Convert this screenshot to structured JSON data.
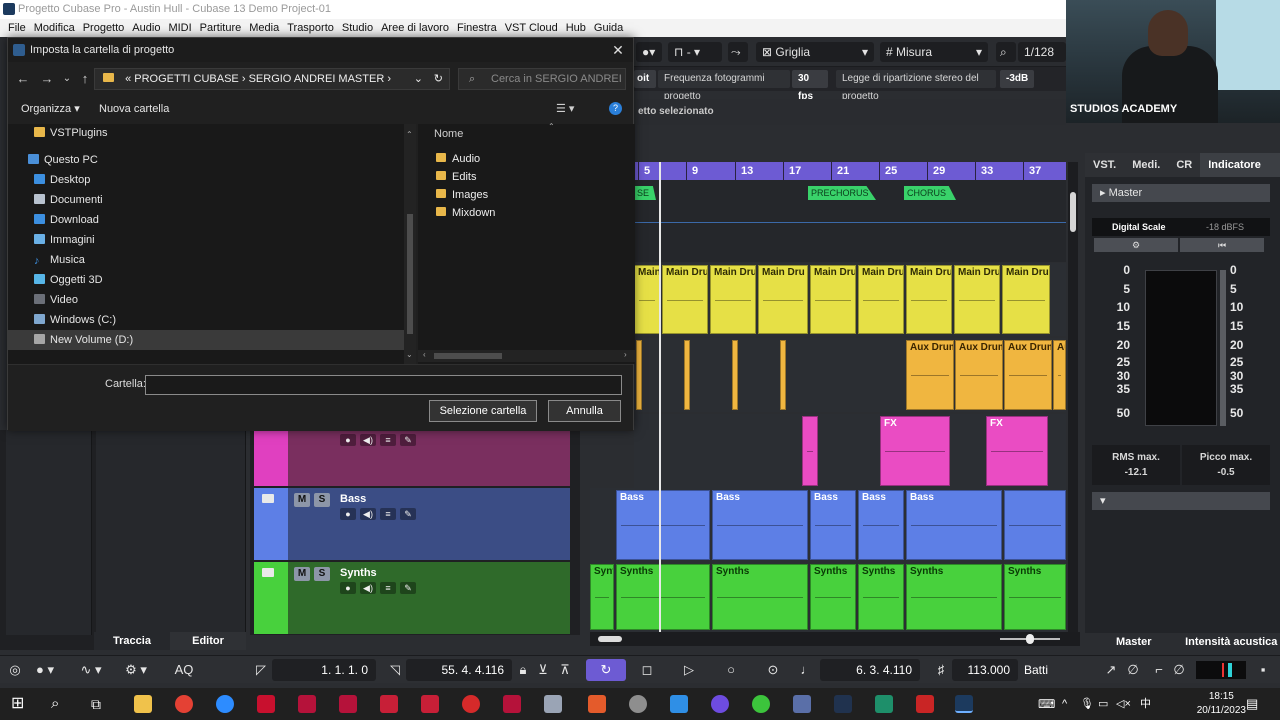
{
  "window": {
    "title": "Progetto Cubase Pro - Austin Hull - Cubase 13 Demo Project-01"
  },
  "menu": [
    "File",
    "Modifica",
    "Progetto",
    "Audio",
    "MIDI",
    "Partiture",
    "Media",
    "Trasporto",
    "Studio",
    "Aree di lavoro",
    "Finestra",
    "VST Cloud",
    "Hub",
    "Guida"
  ],
  "webcam": {
    "label": "STUDIOS ACADEMY"
  },
  "toolbar": {
    "snap_type": "Griglia",
    "grid_type": "Misura",
    "quantize": "1/128",
    "frame_rate_label": "Frequenza fotogrammi progetto",
    "frame_rate_value": "30 fps",
    "pan_law_label": "Legge di ripartizione stereo del progetto",
    "pan_law_value": "-3dB",
    "oit_label": "oit",
    "selected_label": "etto selezionato"
  },
  "ruler": [
    "5",
    "9",
    "13",
    "17",
    "21",
    "25",
    "29",
    "33",
    "37"
  ],
  "markers": [
    {
      "label": "SE"
    },
    {
      "label": "PRECHORUS"
    },
    {
      "label": "CHORUS"
    }
  ],
  "lanes": {
    "main_drums": [
      "Main Dru",
      "Main Dru",
      "Main Dru",
      "Main Dru",
      "Main Dru",
      "Main Dru",
      "Main Dru",
      "Main Dru",
      "Main Dru"
    ],
    "aux_drums": [
      "Aux Drum",
      "Aux Drum",
      "Aux Drum",
      "Au"
    ],
    "fx": [
      "FX",
      "FX"
    ],
    "bass": [
      "Bass",
      "Bass",
      "Bass",
      "Bass",
      "Bass"
    ],
    "synths": [
      "Synt",
      "Synths",
      "Synths",
      "Synths",
      "Synths",
      "Synths",
      "Synths"
    ]
  },
  "tracks": [
    {
      "name": "Bass",
      "m": "M",
      "s": "S",
      "color": "#5d7fe6"
    },
    {
      "name": "Synths",
      "m": "M",
      "s": "S",
      "color": "#48d13d"
    }
  ],
  "inspector_tabs": [
    "Traccia",
    "Editor"
  ],
  "right_panel": {
    "tabs": [
      "VST.",
      "Medi.",
      "CR",
      "Indicatore li."
    ],
    "master": "Master",
    "scale_label": "Digital Scale",
    "scale_value": "-18 dBFS",
    "scale_left": [
      "0",
      "5",
      "10",
      "15",
      "20",
      "25",
      "30",
      "35",
      "50"
    ],
    "scale_right": [
      "0",
      "5",
      "10",
      "15",
      "20",
      "25",
      "30",
      "35",
      "50"
    ],
    "rms_label": "RMS max.",
    "rms_value": "-12.1",
    "peak_label": "Picco max.",
    "peak_value": "-0.5",
    "bottom_tabs": [
      "Master",
      "Intensità acustica"
    ]
  },
  "transport": {
    "aq": "AQ",
    "left_locator": "1. 1. 1.   0",
    "right_locator": "55. 4. 4.116",
    "position": "6. 3. 4.110",
    "tempo": "113.000",
    "beats": "Batti"
  },
  "taskbar": {
    "time": "18:15",
    "date": "20/11/2023"
  },
  "dialog": {
    "title": "Imposta la cartella di progetto",
    "breadcrumb": [
      "PROGETTI CUBASE",
      "SERGIO ANDREI MASTER"
    ],
    "search_placeholder": "Cerca in SERGIO ANDREI MA...",
    "organize": "Organizza",
    "new_folder": "Nuova cartella",
    "nav_items": [
      "VSTPlugins",
      "Questo PC",
      "Desktop",
      "Documenti",
      "Download",
      "Immagini",
      "Musica",
      "Oggetti 3D",
      "Video",
      "Windows (C:)",
      "New Volume (D:)"
    ],
    "column_header": "Nome",
    "files": [
      "Audio",
      "Edits",
      "Images",
      "Mixdown"
    ],
    "field_label": "Cartella:",
    "field_value": "",
    "select_button": "Selezione cartella",
    "cancel_button": "Annulla"
  }
}
